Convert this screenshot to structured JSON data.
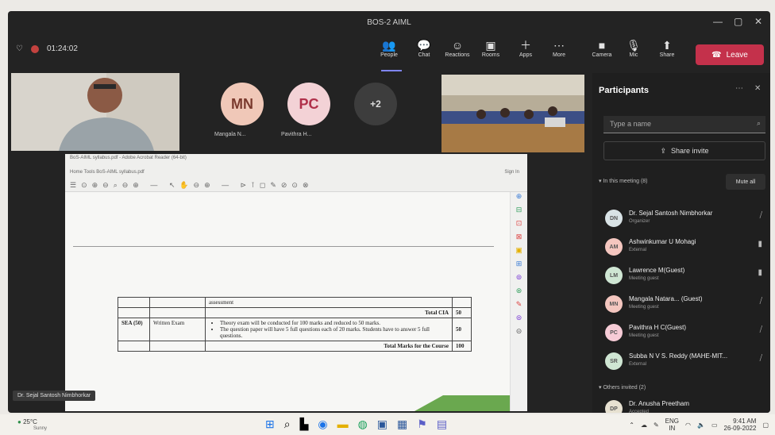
{
  "window": {
    "title": "BOS-2 AIML"
  },
  "meeting": {
    "timer": "01:24:02"
  },
  "toolbar": {
    "buttons": [
      {
        "label": "People",
        "icon": "people-icon",
        "glyph": "👥"
      },
      {
        "label": "Chat",
        "icon": "chat-icon",
        "glyph": "💬"
      },
      {
        "label": "Reactions",
        "icon": "reactions-icon",
        "glyph": "☺"
      },
      {
        "label": "Rooms",
        "icon": "rooms-icon",
        "glyph": "▣"
      },
      {
        "label": "Apps",
        "icon": "apps-icon",
        "glyph": "＋"
      },
      {
        "label": "More",
        "icon": "more-icon",
        "glyph": "⋯"
      },
      {
        "label": "Camera",
        "icon": "camera-icon",
        "glyph": "■"
      },
      {
        "label": "Mic",
        "icon": "mic-icon",
        "glyph": "🎙"
      },
      {
        "label": "Share",
        "icon": "share-icon",
        "glyph": "⬆"
      }
    ],
    "leave_label": "Leave"
  },
  "stage": {
    "avatars": [
      {
        "initials": "MN",
        "name": "Mangala N...",
        "color": "#f0c8b8"
      },
      {
        "initials": "PC",
        "name": "Pavithra H...",
        "color": "#f3d2d6"
      }
    ],
    "overflow_count": "+2",
    "presenter_label": "Dr. Sejal Santosh Nimbhorkar"
  },
  "document": {
    "filename": "BoS-AIML syllabus.pdf - Adobe Acrobat Reader (64-bit)",
    "menu": "Home   Tools   BoS-AIML syllabus.pdf",
    "sign_in": "Sign In",
    "table": {
      "r0": "assessment",
      "total_cia_label": "Total CIA",
      "total_cia_value": "50",
      "code": "SEA (50)",
      "type": "Written Exam",
      "bullet1": "Theory exam will be conducted for 100 marks and reduced to 50 marks.",
      "bullet2": "The question paper will have 5 full questions each of 20 marks. Students have to answer 5 full questions.",
      "value": "50",
      "total_label": "Total Marks for the Course",
      "total_value": "100"
    }
  },
  "participants": {
    "title": "Participants",
    "search_placeholder": "Type a name",
    "share_invite": "Share invite",
    "in_meeting_label": "In this meeting (8)",
    "mute_all": "Mute all",
    "others_label": "Others invited (2)",
    "list": [
      {
        "initials": "DN",
        "name": "Dr. Sejal Santosh Nimbhorkar",
        "role": "Organizer",
        "color": "#d9e3e6"
      },
      {
        "initials": "AM",
        "name": "Ashwinkumar U Mohagi",
        "role": "External",
        "color": "#f4c6bf"
      },
      {
        "initials": "LM",
        "name": "Lawrence M(Guest)",
        "role": "Meeting guest",
        "color": "#cfe6d3"
      },
      {
        "initials": "MN",
        "name": "Mangala Natara... (Guest)",
        "role": "Meeting guest",
        "color": "#f4c6bf"
      },
      {
        "initials": "PC",
        "name": "Pavithra H C(Guest)",
        "role": "Meeting guest",
        "color": "#f6cbd6"
      },
      {
        "initials": "SR",
        "name": "Subba N V S. Reddy (MAHE-MIT...",
        "role": "External",
        "color": "#cfe6d3"
      }
    ],
    "others": [
      {
        "initials": "DP",
        "name": "Dr. Anusha Preetham",
        "role": "Accepted",
        "color": "#e7e1d1"
      }
    ]
  },
  "taskbar": {
    "weather": "25°C",
    "weather_sub": "Sunny",
    "lang": "ENG",
    "lang_sub": "IN",
    "time": "9:41 AM",
    "date": "26-09-2022"
  }
}
